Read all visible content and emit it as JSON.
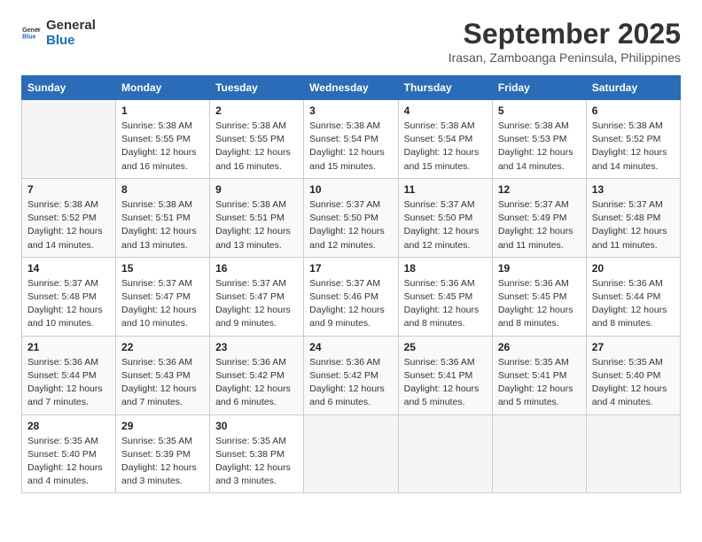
{
  "logo": {
    "line1": "General",
    "line2": "Blue"
  },
  "title": {
    "month_year": "September 2025",
    "location": "Irasan, Zamboanga Peninsula, Philippines"
  },
  "days_header": [
    "Sunday",
    "Monday",
    "Tuesday",
    "Wednesday",
    "Thursday",
    "Friday",
    "Saturday"
  ],
  "weeks": [
    [
      {
        "day": "",
        "info": ""
      },
      {
        "day": "1",
        "info": "Sunrise: 5:38 AM\nSunset: 5:55 PM\nDaylight: 12 hours\nand 16 minutes."
      },
      {
        "day": "2",
        "info": "Sunrise: 5:38 AM\nSunset: 5:55 PM\nDaylight: 12 hours\nand 16 minutes."
      },
      {
        "day": "3",
        "info": "Sunrise: 5:38 AM\nSunset: 5:54 PM\nDaylight: 12 hours\nand 15 minutes."
      },
      {
        "day": "4",
        "info": "Sunrise: 5:38 AM\nSunset: 5:54 PM\nDaylight: 12 hours\nand 15 minutes."
      },
      {
        "day": "5",
        "info": "Sunrise: 5:38 AM\nSunset: 5:53 PM\nDaylight: 12 hours\nand 14 minutes."
      },
      {
        "day": "6",
        "info": "Sunrise: 5:38 AM\nSunset: 5:52 PM\nDaylight: 12 hours\nand 14 minutes."
      }
    ],
    [
      {
        "day": "7",
        "info": "Sunrise: 5:38 AM\nSunset: 5:52 PM\nDaylight: 12 hours\nand 14 minutes."
      },
      {
        "day": "8",
        "info": "Sunrise: 5:38 AM\nSunset: 5:51 PM\nDaylight: 12 hours\nand 13 minutes."
      },
      {
        "day": "9",
        "info": "Sunrise: 5:38 AM\nSunset: 5:51 PM\nDaylight: 12 hours\nand 13 minutes."
      },
      {
        "day": "10",
        "info": "Sunrise: 5:37 AM\nSunset: 5:50 PM\nDaylight: 12 hours\nand 12 minutes."
      },
      {
        "day": "11",
        "info": "Sunrise: 5:37 AM\nSunset: 5:50 PM\nDaylight: 12 hours\nand 12 minutes."
      },
      {
        "day": "12",
        "info": "Sunrise: 5:37 AM\nSunset: 5:49 PM\nDaylight: 12 hours\nand 11 minutes."
      },
      {
        "day": "13",
        "info": "Sunrise: 5:37 AM\nSunset: 5:48 PM\nDaylight: 12 hours\nand 11 minutes."
      }
    ],
    [
      {
        "day": "14",
        "info": "Sunrise: 5:37 AM\nSunset: 5:48 PM\nDaylight: 12 hours\nand 10 minutes."
      },
      {
        "day": "15",
        "info": "Sunrise: 5:37 AM\nSunset: 5:47 PM\nDaylight: 12 hours\nand 10 minutes."
      },
      {
        "day": "16",
        "info": "Sunrise: 5:37 AM\nSunset: 5:47 PM\nDaylight: 12 hours\nand 9 minutes."
      },
      {
        "day": "17",
        "info": "Sunrise: 5:37 AM\nSunset: 5:46 PM\nDaylight: 12 hours\nand 9 minutes."
      },
      {
        "day": "18",
        "info": "Sunrise: 5:36 AM\nSunset: 5:45 PM\nDaylight: 12 hours\nand 8 minutes."
      },
      {
        "day": "19",
        "info": "Sunrise: 5:36 AM\nSunset: 5:45 PM\nDaylight: 12 hours\nand 8 minutes."
      },
      {
        "day": "20",
        "info": "Sunrise: 5:36 AM\nSunset: 5:44 PM\nDaylight: 12 hours\nand 8 minutes."
      }
    ],
    [
      {
        "day": "21",
        "info": "Sunrise: 5:36 AM\nSunset: 5:44 PM\nDaylight: 12 hours\nand 7 minutes."
      },
      {
        "day": "22",
        "info": "Sunrise: 5:36 AM\nSunset: 5:43 PM\nDaylight: 12 hours\nand 7 minutes."
      },
      {
        "day": "23",
        "info": "Sunrise: 5:36 AM\nSunset: 5:42 PM\nDaylight: 12 hours\nand 6 minutes."
      },
      {
        "day": "24",
        "info": "Sunrise: 5:36 AM\nSunset: 5:42 PM\nDaylight: 12 hours\nand 6 minutes."
      },
      {
        "day": "25",
        "info": "Sunrise: 5:36 AM\nSunset: 5:41 PM\nDaylight: 12 hours\nand 5 minutes."
      },
      {
        "day": "26",
        "info": "Sunrise: 5:35 AM\nSunset: 5:41 PM\nDaylight: 12 hours\nand 5 minutes."
      },
      {
        "day": "27",
        "info": "Sunrise: 5:35 AM\nSunset: 5:40 PM\nDaylight: 12 hours\nand 4 minutes."
      }
    ],
    [
      {
        "day": "28",
        "info": "Sunrise: 5:35 AM\nSunset: 5:40 PM\nDaylight: 12 hours\nand 4 minutes."
      },
      {
        "day": "29",
        "info": "Sunrise: 5:35 AM\nSunset: 5:39 PM\nDaylight: 12 hours\nand 3 minutes."
      },
      {
        "day": "30",
        "info": "Sunrise: 5:35 AM\nSunset: 5:38 PM\nDaylight: 12 hours\nand 3 minutes."
      },
      {
        "day": "",
        "info": ""
      },
      {
        "day": "",
        "info": ""
      },
      {
        "day": "",
        "info": ""
      },
      {
        "day": "",
        "info": ""
      }
    ]
  ]
}
